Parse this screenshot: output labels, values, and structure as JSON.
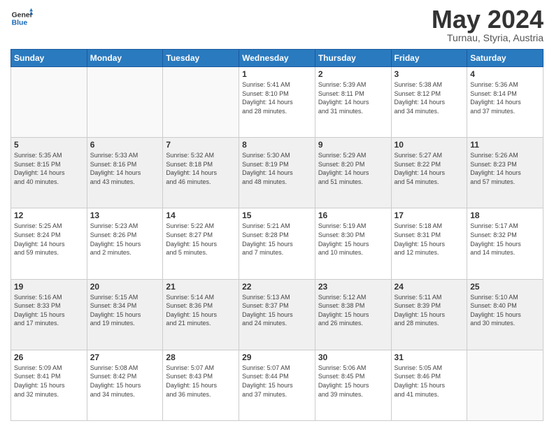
{
  "header": {
    "logo_line1": "General",
    "logo_line2": "Blue",
    "month": "May 2024",
    "location": "Turnau, Styria, Austria"
  },
  "days_of_week": [
    "Sunday",
    "Monday",
    "Tuesday",
    "Wednesday",
    "Thursday",
    "Friday",
    "Saturday"
  ],
  "weeks": [
    [
      {
        "day": "",
        "info": ""
      },
      {
        "day": "",
        "info": ""
      },
      {
        "day": "",
        "info": ""
      },
      {
        "day": "1",
        "info": "Sunrise: 5:41 AM\nSunset: 8:10 PM\nDaylight: 14 hours\nand 28 minutes."
      },
      {
        "day": "2",
        "info": "Sunrise: 5:39 AM\nSunset: 8:11 PM\nDaylight: 14 hours\nand 31 minutes."
      },
      {
        "day": "3",
        "info": "Sunrise: 5:38 AM\nSunset: 8:12 PM\nDaylight: 14 hours\nand 34 minutes."
      },
      {
        "day": "4",
        "info": "Sunrise: 5:36 AM\nSunset: 8:14 PM\nDaylight: 14 hours\nand 37 minutes."
      }
    ],
    [
      {
        "day": "5",
        "info": "Sunrise: 5:35 AM\nSunset: 8:15 PM\nDaylight: 14 hours\nand 40 minutes."
      },
      {
        "day": "6",
        "info": "Sunrise: 5:33 AM\nSunset: 8:16 PM\nDaylight: 14 hours\nand 43 minutes."
      },
      {
        "day": "7",
        "info": "Sunrise: 5:32 AM\nSunset: 8:18 PM\nDaylight: 14 hours\nand 46 minutes."
      },
      {
        "day": "8",
        "info": "Sunrise: 5:30 AM\nSunset: 8:19 PM\nDaylight: 14 hours\nand 48 minutes."
      },
      {
        "day": "9",
        "info": "Sunrise: 5:29 AM\nSunset: 8:20 PM\nDaylight: 14 hours\nand 51 minutes."
      },
      {
        "day": "10",
        "info": "Sunrise: 5:27 AM\nSunset: 8:22 PM\nDaylight: 14 hours\nand 54 minutes."
      },
      {
        "day": "11",
        "info": "Sunrise: 5:26 AM\nSunset: 8:23 PM\nDaylight: 14 hours\nand 57 minutes."
      }
    ],
    [
      {
        "day": "12",
        "info": "Sunrise: 5:25 AM\nSunset: 8:24 PM\nDaylight: 14 hours\nand 59 minutes."
      },
      {
        "day": "13",
        "info": "Sunrise: 5:23 AM\nSunset: 8:26 PM\nDaylight: 15 hours\nand 2 minutes."
      },
      {
        "day": "14",
        "info": "Sunrise: 5:22 AM\nSunset: 8:27 PM\nDaylight: 15 hours\nand 5 minutes."
      },
      {
        "day": "15",
        "info": "Sunrise: 5:21 AM\nSunset: 8:28 PM\nDaylight: 15 hours\nand 7 minutes."
      },
      {
        "day": "16",
        "info": "Sunrise: 5:19 AM\nSunset: 8:30 PM\nDaylight: 15 hours\nand 10 minutes."
      },
      {
        "day": "17",
        "info": "Sunrise: 5:18 AM\nSunset: 8:31 PM\nDaylight: 15 hours\nand 12 minutes."
      },
      {
        "day": "18",
        "info": "Sunrise: 5:17 AM\nSunset: 8:32 PM\nDaylight: 15 hours\nand 14 minutes."
      }
    ],
    [
      {
        "day": "19",
        "info": "Sunrise: 5:16 AM\nSunset: 8:33 PM\nDaylight: 15 hours\nand 17 minutes."
      },
      {
        "day": "20",
        "info": "Sunrise: 5:15 AM\nSunset: 8:34 PM\nDaylight: 15 hours\nand 19 minutes."
      },
      {
        "day": "21",
        "info": "Sunrise: 5:14 AM\nSunset: 8:36 PM\nDaylight: 15 hours\nand 21 minutes."
      },
      {
        "day": "22",
        "info": "Sunrise: 5:13 AM\nSunset: 8:37 PM\nDaylight: 15 hours\nand 24 minutes."
      },
      {
        "day": "23",
        "info": "Sunrise: 5:12 AM\nSunset: 8:38 PM\nDaylight: 15 hours\nand 26 minutes."
      },
      {
        "day": "24",
        "info": "Sunrise: 5:11 AM\nSunset: 8:39 PM\nDaylight: 15 hours\nand 28 minutes."
      },
      {
        "day": "25",
        "info": "Sunrise: 5:10 AM\nSunset: 8:40 PM\nDaylight: 15 hours\nand 30 minutes."
      }
    ],
    [
      {
        "day": "26",
        "info": "Sunrise: 5:09 AM\nSunset: 8:41 PM\nDaylight: 15 hours\nand 32 minutes."
      },
      {
        "day": "27",
        "info": "Sunrise: 5:08 AM\nSunset: 8:42 PM\nDaylight: 15 hours\nand 34 minutes."
      },
      {
        "day": "28",
        "info": "Sunrise: 5:07 AM\nSunset: 8:43 PM\nDaylight: 15 hours\nand 36 minutes."
      },
      {
        "day": "29",
        "info": "Sunrise: 5:07 AM\nSunset: 8:44 PM\nDaylight: 15 hours\nand 37 minutes."
      },
      {
        "day": "30",
        "info": "Sunrise: 5:06 AM\nSunset: 8:45 PM\nDaylight: 15 hours\nand 39 minutes."
      },
      {
        "day": "31",
        "info": "Sunrise: 5:05 AM\nSunset: 8:46 PM\nDaylight: 15 hours\nand 41 minutes."
      },
      {
        "day": "",
        "info": ""
      }
    ]
  ]
}
